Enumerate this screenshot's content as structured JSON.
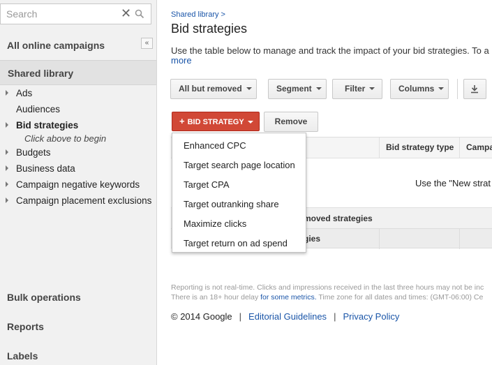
{
  "sidebar": {
    "search": {
      "placeholder": "Search",
      "value": ""
    },
    "all_campaigns": "All online campaigns",
    "collapse_label": "«",
    "shared_library": "Shared library",
    "tree": [
      "Ads",
      "Audiences",
      "Bid strategies",
      "Budgets",
      "Business data",
      "Campaign negative keywords",
      "Campaign placement exclusions"
    ],
    "hint": "Click above to begin",
    "bulk_operations": "Bulk operations",
    "reports": "Reports",
    "labels": "Labels"
  },
  "main": {
    "breadcrumb": "Shared library >",
    "title": "Bid strategies",
    "description": "Use the table below to manage and track the impact of your bid strategies. To a",
    "more": "more",
    "toolbar": {
      "all_but_removed": "All but removed",
      "segment": "Segment",
      "filter": "Filter",
      "columns": "Columns"
    },
    "bid_strategy_button": "BID STRATEGY",
    "remove_button": "Remove",
    "table": {
      "headers": [
        "Bid strategy type",
        "Campa"
      ],
      "empty_message": "Use the \"New strat",
      "removed_row": "moved strategies",
      "total_row": "gies"
    },
    "dropdown": [
      "Enhanced CPC",
      "Target search page location",
      "Target CPA",
      "Target outranking share",
      "Maximize clicks",
      "Target return on ad spend"
    ],
    "report_note": {
      "line1": "Reporting is not real-time. Clicks and impressions received in the last three hours may not be inc",
      "line2_pre": "There is an 18+ hour delay ",
      "line2_link": "for some metrics.",
      "line2_post": " Time zone for all dates and times: (GMT-06:00) Ce"
    },
    "footer": {
      "copyright": "© 2014 Google",
      "separator": "|",
      "editorial": "Editorial Guidelines",
      "privacy": "Privacy Policy"
    }
  },
  "colors": {
    "accent_red": "#d14836",
    "link_blue": "#1a55a8"
  }
}
